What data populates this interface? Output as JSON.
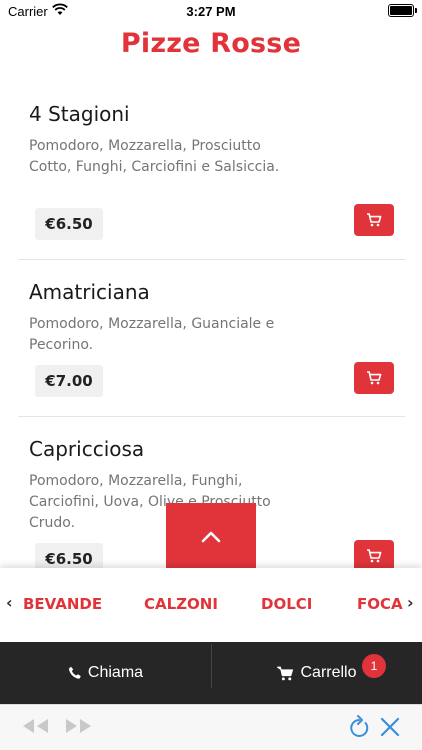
{
  "status_bar": {
    "carrier": "Carrier",
    "time": "3:27 PM"
  },
  "title": "Pizze Rosse",
  "items": [
    {
      "name": "4 Stagioni",
      "description": "Pomodoro, Mozzarella, Prosciutto Cotto, Funghi, Carciofini e Salsiccia.",
      "price": "€6.50"
    },
    {
      "name": "Amatriciana",
      "description": "Pomodoro, Mozzarella, Guanciale e Pecorino.",
      "price": "€7.00"
    },
    {
      "name": "Capricciosa",
      "description": "Pomodoro, Mozzarella, Funghi, Carciofini, Uova, Olive e Prosciutto Crudo.",
      "price": "€6.50"
    }
  ],
  "categories": [
    "BEVANDE",
    "CALZONI",
    "DOLCI",
    "FOCA"
  ],
  "actions": {
    "call_label": "Chiama",
    "cart_label": "Carrello",
    "cart_count": "1"
  },
  "colors": {
    "accent": "#e0343a",
    "action_bar": "#262626",
    "browser_icon": "#3b8fd9"
  },
  "icons": {
    "cart": "cart-icon",
    "phone": "phone-icon",
    "scroll_top": "chevron-up-icon",
    "refresh": "refresh-icon",
    "close": "close-icon"
  }
}
